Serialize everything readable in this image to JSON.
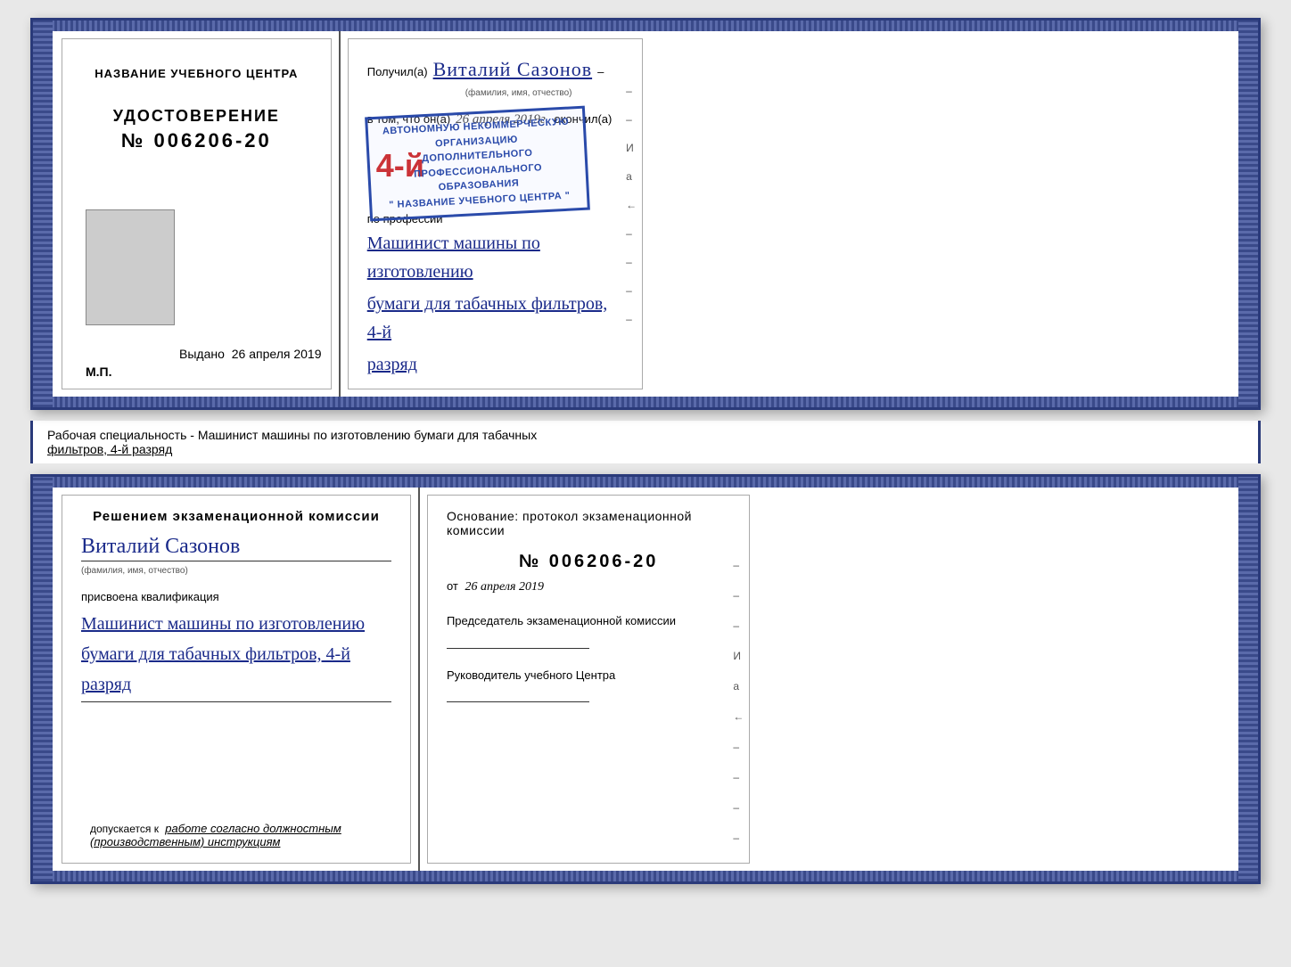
{
  "doc_top": {
    "left": {
      "training_center_label": "НАЗВАНИЕ УЧЕБНОГО ЦЕНТРА",
      "cert_label": "УДОСТОВЕРЕНИЕ",
      "cert_number": "№ 006206-20",
      "issued_label": "Выдано",
      "issued_date": "26 апреля 2019",
      "mp_label": "М.П."
    },
    "right": {
      "received_prefix": "Получил(а)",
      "recipient_name": "Виталий Сазонов",
      "name_caption": "(фамилия, имя, отчество)",
      "dash": "–",
      "vtom_prefix": "в том, что он(а)",
      "vtom_date": "26 апреля 2019г.",
      "okончil": "окончил(а)",
      "stamp_line1": "4-Й",
      "stamp_line2": "АВТОНОМНУЮ НЕКОММЕРЧЕСКУЮ ОРГАНИЗАЦИЮ",
      "stamp_line3": "ДОПОЛНИТЕЛЬНОГО ПРОФЕССИОНАЛЬНОГО ОБРАЗОВАНИЯ",
      "stamp_line4": "\" НАЗВАНИЕ УЧЕБНОГО ЦЕНТРА \"",
      "profession_label": "по профессии",
      "profession_hw1": "Машинист машины по изготовлению",
      "profession_hw2": "бумаги для табачных фильтров, 4-й",
      "profession_hw3": "разряд"
    }
  },
  "middle_label": {
    "text": "Рабочая специальность - Машинист машины по изготовлению бумаги для табачных",
    "text2": "фильтров, 4-й разряд"
  },
  "doc_bottom": {
    "left": {
      "title": "Решением экзаменационной комиссии",
      "person_name": "Виталий Сазонов",
      "name_caption": "(фамилия, имя, отчество)",
      "assigned_text": "присвоена квалификация",
      "qual_line1": "Машинист машины по изготовлению",
      "qual_line2": "бумаги для табачных фильтров, 4-й",
      "qual_line3": "разряд",
      "allowed_prefix": "допускается к",
      "allowed_text": "работе согласно должностным (производственным) инструкциям"
    },
    "right": {
      "osnov_label": "Основание: протокол экзаменационной комиссии",
      "protocol_number": "№  006206-20",
      "ot_prefix": "от",
      "ot_date": "26 апреля 2019",
      "chairman_title": "Председатель экзаменационной комиссии",
      "head_title": "Руководитель учебного Центра"
    }
  }
}
